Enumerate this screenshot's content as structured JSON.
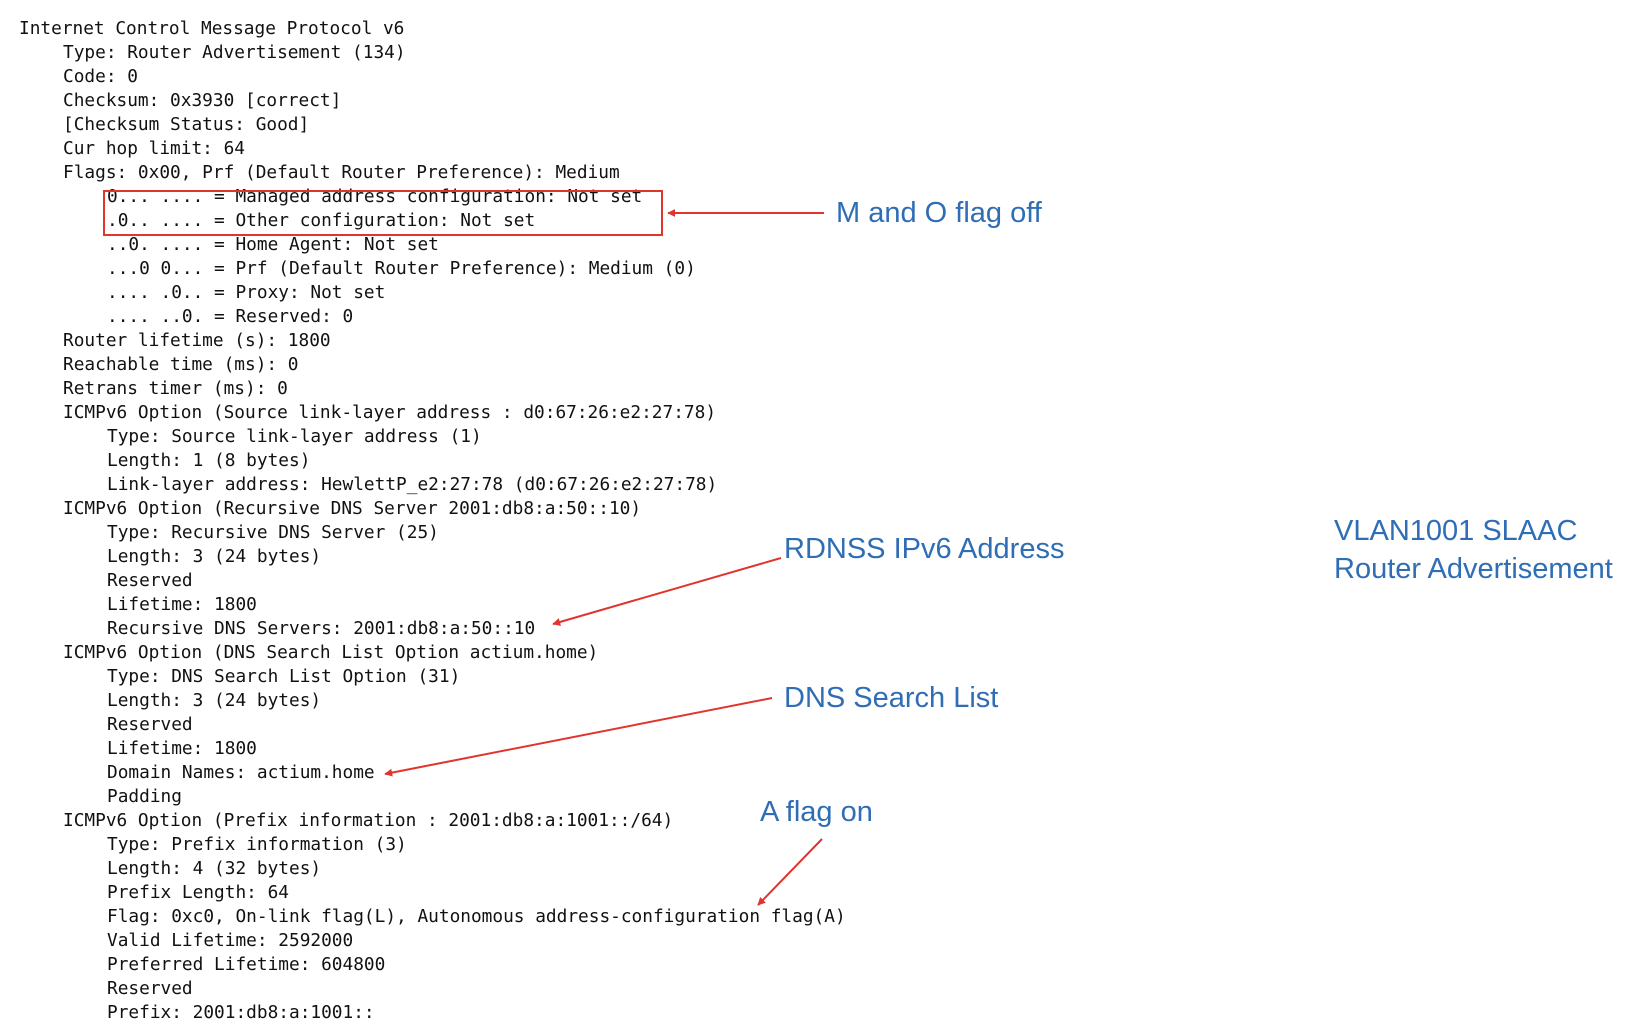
{
  "packet_lines": [
    {
      "indent": 0,
      "text": "Internet Control Message Protocol v6"
    },
    {
      "indent": 1,
      "text": "Type: Router Advertisement (134)"
    },
    {
      "indent": 1,
      "text": "Code: 0"
    },
    {
      "indent": 1,
      "text": "Checksum: 0x3930 [correct]"
    },
    {
      "indent": 1,
      "text": "[Checksum Status: Good]"
    },
    {
      "indent": 1,
      "text": "Cur hop limit: 64"
    },
    {
      "indent": 1,
      "text": "Flags: 0x00, Prf (Default Router Preference): Medium"
    },
    {
      "indent": 2,
      "text": "0... .... = Managed address configuration: Not set"
    },
    {
      "indent": 2,
      "text": ".0.. .... = Other configuration: Not set"
    },
    {
      "indent": 2,
      "text": "..0. .... = Home Agent: Not set"
    },
    {
      "indent": 2,
      "text": "...0 0... = Prf (Default Router Preference): Medium (0)"
    },
    {
      "indent": 2,
      "text": ".... .0.. = Proxy: Not set"
    },
    {
      "indent": 2,
      "text": ".... ..0. = Reserved: 0"
    },
    {
      "indent": 1,
      "text": "Router lifetime (s): 1800"
    },
    {
      "indent": 1,
      "text": "Reachable time (ms): 0"
    },
    {
      "indent": 1,
      "text": "Retrans timer (ms): 0"
    },
    {
      "indent": 1,
      "text": "ICMPv6 Option (Source link-layer address : d0:67:26:e2:27:78)"
    },
    {
      "indent": 2,
      "text": "Type: Source link-layer address (1)"
    },
    {
      "indent": 2,
      "text": "Length: 1 (8 bytes)"
    },
    {
      "indent": 2,
      "text": "Link-layer address: HewlettP_e2:27:78 (d0:67:26:e2:27:78)"
    },
    {
      "indent": 1,
      "text": "ICMPv6 Option (Recursive DNS Server 2001:db8:a:50::10)"
    },
    {
      "indent": 2,
      "text": "Type: Recursive DNS Server (25)"
    },
    {
      "indent": 2,
      "text": "Length: 3 (24 bytes)"
    },
    {
      "indent": 2,
      "text": "Reserved"
    },
    {
      "indent": 2,
      "text": "Lifetime: 1800"
    },
    {
      "indent": 2,
      "text": "Recursive DNS Servers: 2001:db8:a:50::10"
    },
    {
      "indent": 1,
      "text": "ICMPv6 Option (DNS Search List Option actium.home)"
    },
    {
      "indent": 2,
      "text": "Type: DNS Search List Option (31)"
    },
    {
      "indent": 2,
      "text": "Length: 3 (24 bytes)"
    },
    {
      "indent": 2,
      "text": "Reserved"
    },
    {
      "indent": 2,
      "text": "Lifetime: 1800"
    },
    {
      "indent": 2,
      "text": "Domain Names: actium.home"
    },
    {
      "indent": 2,
      "text": "Padding"
    },
    {
      "indent": 1,
      "text": "ICMPv6 Option (Prefix information : 2001:db8:a:1001::/64)"
    },
    {
      "indent": 2,
      "text": "Type: Prefix information (3)"
    },
    {
      "indent": 2,
      "text": "Length: 4 (32 bytes)"
    },
    {
      "indent": 2,
      "text": "Prefix Length: 64"
    },
    {
      "indent": 2,
      "text": "Flag: 0xc0, On-link flag(L), Autonomous address-configuration flag(A)"
    },
    {
      "indent": 2,
      "text": "Valid Lifetime: 2592000"
    },
    {
      "indent": 2,
      "text": "Preferred Lifetime: 604800"
    },
    {
      "indent": 2,
      "text": "Reserved"
    },
    {
      "indent": 2,
      "text": "Prefix: 2001:db8:a:1001::"
    }
  ],
  "annotations": {
    "mo_flag": "M and O flag off",
    "rdnss": "RDNSS IPv6 Address",
    "dns_search": "DNS Search List",
    "a_flag": "A flag on"
  },
  "title": {
    "line1": "VLAN1001 SLAAC",
    "line2": "Router Advertisement"
  },
  "colors": {
    "annotation_text": "#2f6db4",
    "arrow": "#e0342c",
    "packet_text": "#111111"
  }
}
